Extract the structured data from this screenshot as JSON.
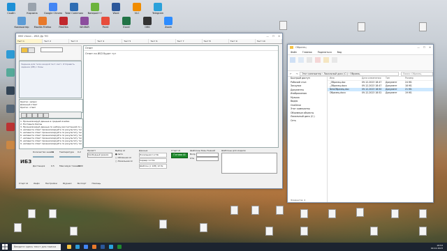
{
  "desktop": {
    "top_icons": [
      {
        "label": "Скайп",
        "color": "#1e90d6"
      },
      {
        "label": "Компьютер",
        "color": "#5b9bd5"
      },
      {
        "label": "Корзина",
        "color": "#9aa3ad"
      },
      {
        "label": "Mozilla Firefox",
        "color": "#e8792b"
      },
      {
        "label": "Google Chrome",
        "color": "#4285f4"
      },
      {
        "label": "FileZilla",
        "color": "#c1272d"
      },
      {
        "label": "Total Commander",
        "color": "#2f6db3"
      },
      {
        "label": "WinRAR",
        "color": "#8c4d9e"
      },
      {
        "label": "Notepad++",
        "color": "#6bb33c"
      },
      {
        "label": "Paint",
        "color": "#e74c3c"
      },
      {
        "label": "Word",
        "color": "#2b579a"
      },
      {
        "label": "Excel",
        "color": "#217346"
      },
      {
        "label": "VLC",
        "color": "#f08c00"
      },
      {
        "label": "OBS",
        "color": "#333333"
      },
      {
        "label": "Telegram",
        "color": "#2aa1da"
      },
      {
        "label": "Zoom",
        "color": "#2d8cff"
      }
    ]
  },
  "app": {
    "title": "IMIS Vision – ИБЗ Др ТЮ",
    "tabs": [
      "Тест 1",
      "Тест 2",
      "Тест 3",
      "Тест 4",
      "Тест 5",
      "Тест 6",
      "Тест 7",
      "Тест 8",
      "Тест 9",
      "Тест 10"
    ],
    "answer_header": "Ответ",
    "answer_text": "Ответ на ИБЗ будет тут",
    "left_hint": "Задание для тела каждой тест-лист. Отправить задание (ИБ) с базы",
    "mini_list": [
      "Кратко: запрос",
      "Длинный ответ",
      "Кратко: ответ"
    ],
    "log_lines": [
      "1. Проанализируй данные в средней ячейке",
      "2. Поставьте баллы",
      "3. Проанализируй данные по набору рассчитанной по и как. ТУ АП",
      "4. напишите ответ проанализируйте по результату тестирования Пост",
      "5. напишите ответ проанализируйте по результату тестирования Пост",
      "6. напишите ответ проанализируйте по результату тестирования Пост",
      "7. напишите ответ проанализируйте по результату тестирования Пост",
      "8. напишите ответ проанализируйте по результату тестирования Пост",
      "9. напишите ответ проанализируйте по результату тестирования Пост"
    ],
    "ibz_label": "ИБЗ",
    "params": {
      "count_label": "Количество знаков",
      "count_value": "10",
      "temp_label": "Температура",
      "temp_value": "0.2",
      "tokens_label": "Максимум токенов",
      "tokens_value": "2000",
      "dist_label": "Дистанция",
      "dist_value": "0.5"
    },
    "prompt_label": "Промпт",
    "prompt_value": "Свободный режим",
    "model_label": "Выбор AI",
    "models": [
      "Авто",
      "Облачная AI",
      "Локальная AI"
    ],
    "selected_model": "Авто",
    "data_label": "Данные",
    "data_items": [
      "Локальная 1.2 бк",
      "Сервер 1.2 бк",
      "Шаблон (с 128) 12 бк"
    ],
    "start_label": "Старт AI",
    "go_button": "Готово AI",
    "search_label": "Шаблоны базы Знаний",
    "field_labels": [
      "Вопр",
      "Отв"
    ],
    "tree_label": "Шаблоны для модели",
    "bottom_actions": [
      "Старт AI",
      "Инфо",
      "Настройки",
      "Журнал",
      "Экспорт",
      "Помощь"
    ]
  },
  "explorer": {
    "title": "Образец",
    "ribbon": [
      "Файл",
      "Главная",
      "Поделиться",
      "Вид"
    ],
    "address": "Этот компьютер › Локальный диск (C:) › Образец",
    "search_placeholder": "Поиск: Образец",
    "sidebar": [
      "Быстрый доступ",
      "Рабочий стол",
      "Загрузки",
      "Документы",
      "Изображения",
      "Музыка",
      "Видео",
      "OneDrive",
      "Этот компьютер",
      "Объемные объекты",
      "Локальный диск (C:)",
      "Сеть"
    ],
    "columns": [
      "Имя",
      "Дата изменения",
      "Тип",
      "Размер"
    ],
    "files": [
      {
        "name": "_Образец.doc",
        "date": "09.12.2023 18:47",
        "type": "Документ",
        "size": "24 КБ"
      },
      {
        "name": "_Образец.docx",
        "date": "09.12.2023 18:47",
        "type": "Документ",
        "size": "18 КБ"
      },
      {
        "name": "NewОбразец.doc",
        "date": "09.12.2023 18:50",
        "type": "Документ",
        "size": "21 КБ"
      },
      {
        "name": "Образец.docx",
        "date": "09.12.2023 18:52",
        "type": "Документ",
        "size": "19 КБ"
      }
    ],
    "status": "Элементов: 4"
  },
  "taskbar": {
    "search_placeholder": "Введите здесь текст для поиска",
    "time": "18:53",
    "date": "09.12.2023",
    "apps": [
      {
        "name": "explorer",
        "color": "#f5c242"
      },
      {
        "name": "edge",
        "color": "#2d9bd6"
      },
      {
        "name": "chrome",
        "color": "#4285f4"
      },
      {
        "name": "firefox",
        "color": "#e8792b"
      },
      {
        "name": "word",
        "color": "#2b579a"
      },
      {
        "name": "telegram",
        "color": "#2aa1da"
      },
      {
        "name": "app",
        "color": "#1f8a2e"
      }
    ]
  }
}
